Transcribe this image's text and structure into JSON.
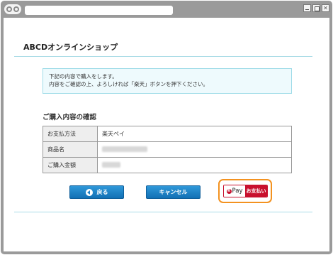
{
  "shop": {
    "title": "ABCDオンラインショップ"
  },
  "notice": {
    "line1": "下記の内容で購入をします。",
    "line2": "内容をご確認の上、よろしければ「楽天」ボタンを押下ください。"
  },
  "confirm": {
    "title": "ご購入内容の確認",
    "rows": [
      {
        "label": "お支払方法",
        "value": "楽天ペイ"
      },
      {
        "label": "商品名",
        "value": ""
      },
      {
        "label": "ご購入金額",
        "value": ""
      }
    ]
  },
  "buttons": {
    "back_label": "戻る",
    "cancel_label": "キャンセル",
    "pay_brand_mark": "R",
    "pay_brand_text": "Pay",
    "pay_action_label": "お支払い"
  },
  "colors": {
    "accent_blue": "#1a7fc4",
    "rule": "#a9dbe6",
    "pay_red": "#c8102e",
    "highlight_orange": "#f39220"
  },
  "icons": {
    "back": "arrow-left-icon",
    "nav": "browser-nav-icon",
    "minimize": "minimize-icon",
    "maximize": "maximize-icon",
    "close": "close-icon"
  }
}
